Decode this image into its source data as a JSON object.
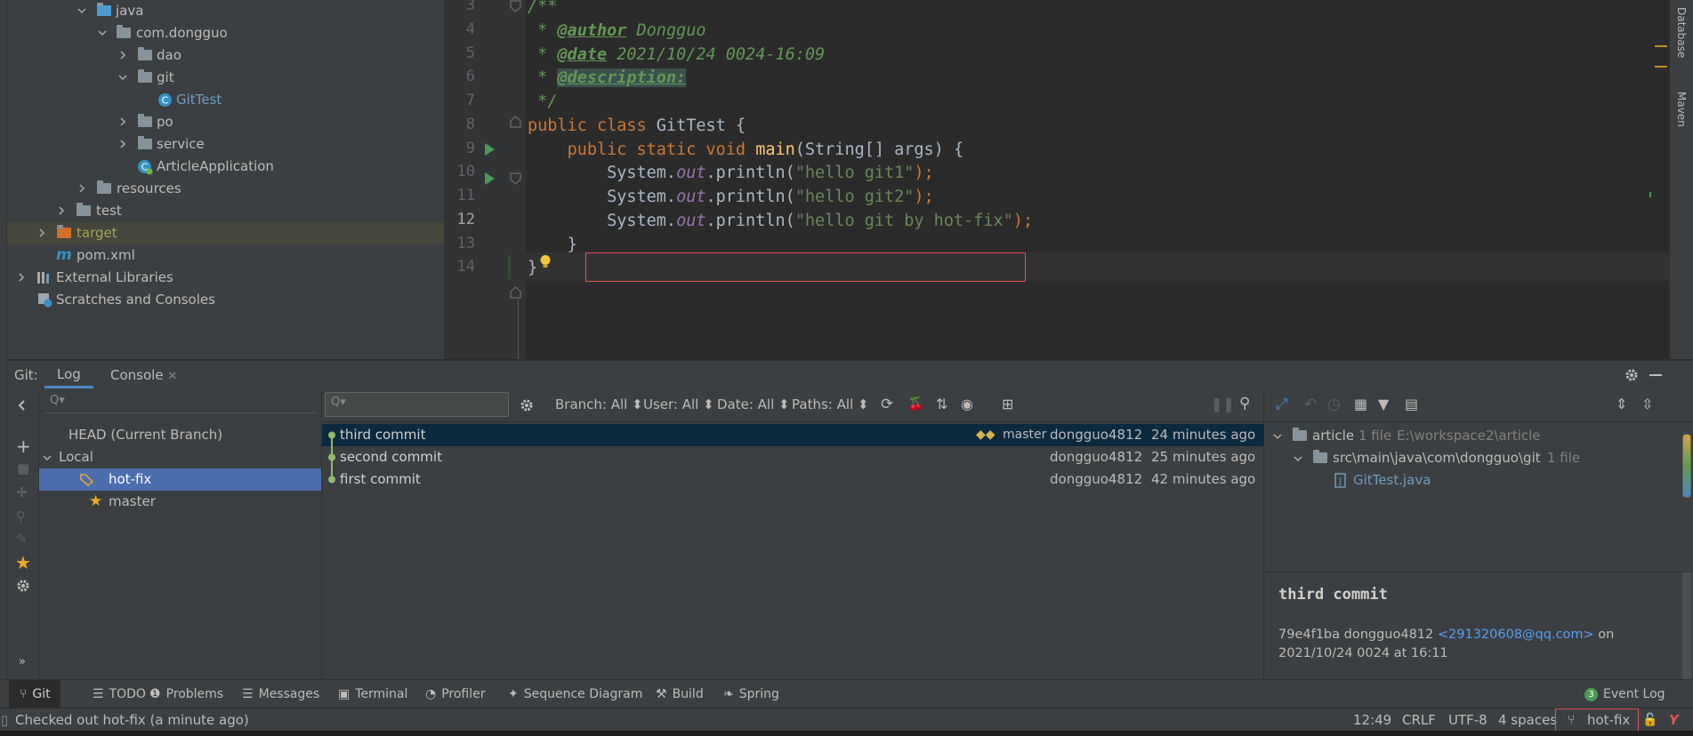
{
  "colors": {
    "accent": "#4b6eaf",
    "selection": "#0d293e",
    "red": "#e05555",
    "green": "#499c54"
  },
  "tree": {
    "java": "java",
    "pkg": "com.dongguo",
    "dao": "dao",
    "git": "git",
    "gittest": "GitTest",
    "po": "po",
    "service": "service",
    "app": "ArticleApplication",
    "resources": "resources",
    "test": "test",
    "target": "target",
    "pom": "pom.xml",
    "libs": "External Libraries",
    "scratches": "Scratches and Consoles"
  },
  "editor": {
    "line_numbers": [
      "3",
      "4",
      "5",
      "6",
      "7",
      "8",
      "9",
      "10",
      "11",
      "12",
      "13",
      "14"
    ],
    "l3": "/**",
    "l4_star": " * ",
    "l4_tag": "@author",
    "l4_val": " Dongguo",
    "l5_star": " * ",
    "l5_tag": "@date",
    "l5_val": " 2021/10/24 0024-16:09",
    "l6_star": " * ",
    "l6_tag": "@description:",
    "l7": " */",
    "l8_kw": "public class ",
    "l8_name": "GitTest {",
    "l9_kw": "public static void ",
    "l9_fn": "main",
    "l9_rest": "(String[] args) {",
    "println_a": "System.",
    "println_out": "out",
    "println_b": ".println(",
    "l10_str": "\"hello git1\"",
    "l11_str": "\"hello git2\"",
    "l12_str": "\"hello git by hot-fix\"",
    "close_paren": ");",
    "l13": "}",
    "l14": "}"
  },
  "rightbar": {
    "database": "Database",
    "maven": "Maven"
  },
  "git_header": {
    "prefix": "Git:",
    "tab_log": "Log",
    "tab_console": "Console"
  },
  "branches": {
    "search_placeholder": "Q▾",
    "head": "HEAD (Current Branch)",
    "local": "Local",
    "hot_fix": "hot-fix",
    "master": "master"
  },
  "log_toolbar": {
    "branch": "Branch: All",
    "user": "User: All",
    "date": "Date: All",
    "paths": "Paths: All"
  },
  "commits": [
    {
      "msg": "third commit",
      "tag": "master",
      "author": "dongguo4812",
      "time": "24 minutes ago"
    },
    {
      "msg": "second commit",
      "author": "dongguo4812",
      "time": "25 minutes ago"
    },
    {
      "msg": "first commit",
      "author": "dongguo4812",
      "time": "42 minutes ago"
    }
  ],
  "changes": {
    "root": "article",
    "root_count": "1 file",
    "root_path": "E:\\workspace2\\article",
    "dir": "src\\main\\java\\com\\dongguo\\git",
    "dir_count": "1 file",
    "file": "GitTest.java",
    "commit_title": "third commit",
    "hash_author": "79e4f1ba dongguo4812 ",
    "email": "<291320608@qq.com>",
    "on": " on",
    "date": "2021/10/24 0024 at 16:11"
  },
  "toolwindows": [
    "Git",
    "TODO",
    "Problems",
    "Messages",
    "Terminal",
    "Profiler",
    "Sequence Diagram",
    "Build",
    "Spring"
  ],
  "event_log": {
    "count": "3",
    "label": "Event Log"
  },
  "status": {
    "message": "Checked out hot-fix (a minute ago)",
    "position": "12:49",
    "line_sep": "CRLF",
    "encoding": "UTF-8",
    "indent": "4 spaces",
    "branch": "hot-fix"
  }
}
